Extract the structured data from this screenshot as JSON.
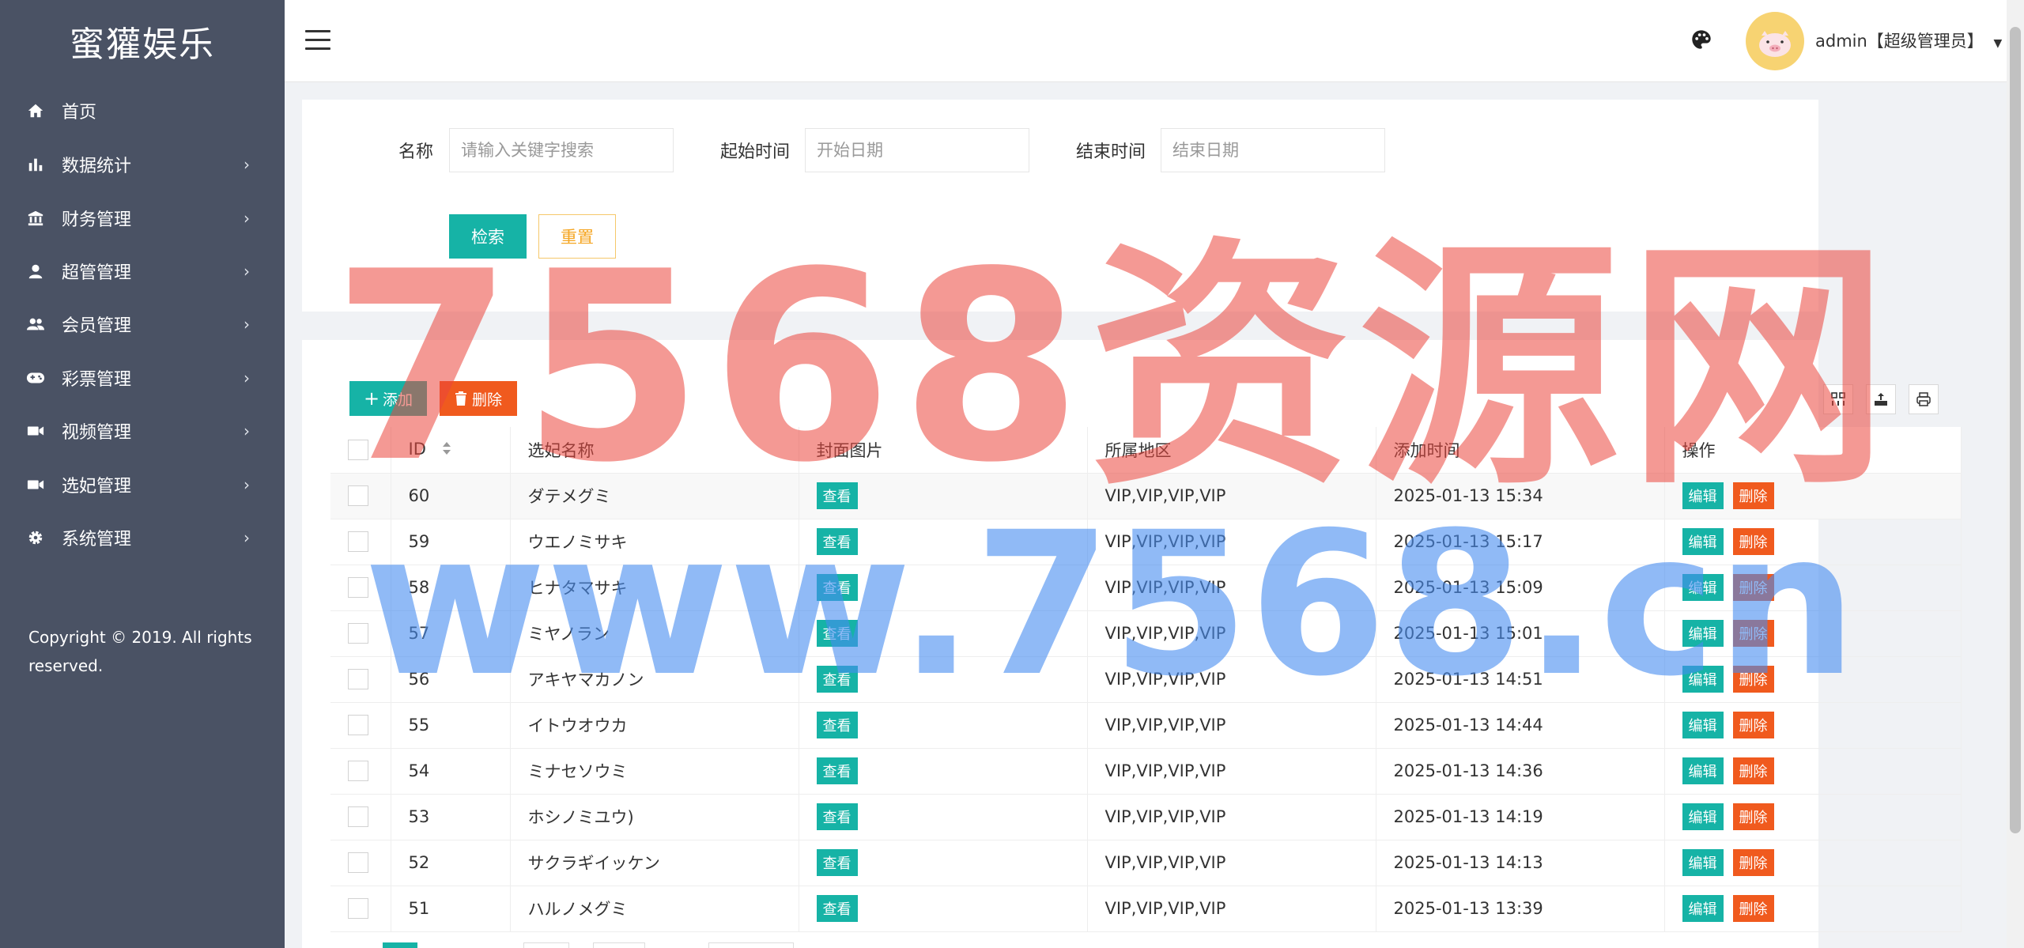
{
  "sidebar": {
    "brand": "蜜獾娱乐",
    "items": [
      {
        "label": "首页",
        "icon": "home-icon"
      },
      {
        "label": "数据统计",
        "icon": "bar-chart-icon"
      },
      {
        "label": "财务管理",
        "icon": "bank-icon"
      },
      {
        "label": "超管管理",
        "icon": "user-icon"
      },
      {
        "label": "会员管理",
        "icon": "users-icon"
      },
      {
        "label": "彩票管理",
        "icon": "gamepad-icon"
      },
      {
        "label": "视频管理",
        "icon": "video-icon"
      },
      {
        "label": "选妃管理",
        "icon": "video-icon"
      },
      {
        "label": "系统管理",
        "icon": "gear-icon"
      }
    ],
    "copyright": "Copyright © 2019. All rights reserved."
  },
  "header": {
    "user": "admin【超级管理员】"
  },
  "search": {
    "name_label": "名称",
    "name_placeholder": "请输入关键字搜索",
    "start_label": "起始时间",
    "start_placeholder": "开始日期",
    "end_label": "结束时间",
    "end_placeholder": "结束日期",
    "search_button": "检索",
    "reset_button": "重置"
  },
  "toolbar": {
    "add_label": "添加",
    "delete_label": "删除"
  },
  "table": {
    "columns": [
      "ID",
      "选妃名称",
      "封面图片",
      "所属地区",
      "添加时间",
      "操作"
    ],
    "view_label": "查看",
    "edit_label": "编辑",
    "remove_label": "删除",
    "rows": [
      {
        "id": "60",
        "name": "ダテメグミ",
        "region": "VIP,VIP,VIP,VIP",
        "time": "2025-01-13 15:34"
      },
      {
        "id": "59",
        "name": "ウエノミサキ",
        "region": "VIP,VIP,VIP,VIP",
        "time": "2025-01-13 15:17"
      },
      {
        "id": "58",
        "name": "ヒナタマサキ",
        "region": "VIP,VIP,VIP,VIP",
        "time": "2025-01-13 15:09"
      },
      {
        "id": "57",
        "name": "ミヤノラン",
        "region": "VIP,VIP,VIP,VIP",
        "time": "2025-01-13 15:01"
      },
      {
        "id": "56",
        "name": "アキヤマカノン",
        "region": "VIP,VIP,VIP,VIP",
        "time": "2025-01-13 14:51"
      },
      {
        "id": "55",
        "name": "イトウオウカ",
        "region": "VIP,VIP,VIP,VIP",
        "time": "2025-01-13 14:44"
      },
      {
        "id": "54",
        "name": "ミナセソウミ",
        "region": "VIP,VIP,VIP,VIP",
        "time": "2025-01-13 14:36"
      },
      {
        "id": "53",
        "name": "ホシノミユウ)",
        "region": "VIP,VIP,VIP,VIP",
        "time": "2025-01-13 14:19"
      },
      {
        "id": "52",
        "name": "サクラギイッケン",
        "region": "VIP,VIP,VIP,VIP",
        "time": "2025-01-13 14:13"
      },
      {
        "id": "51",
        "name": "ハルノメグミ",
        "region": "VIP,VIP,VIP,VIP",
        "time": "2025-01-13 13:39"
      }
    ]
  },
  "watermark": {
    "line1": "7568资源网",
    "line2": "www.7568.cn"
  },
  "colors": {
    "sidebar": "#4a5264",
    "primary": "#16b3a6",
    "danger": "#f05a1e",
    "warning": "#f5a623"
  }
}
